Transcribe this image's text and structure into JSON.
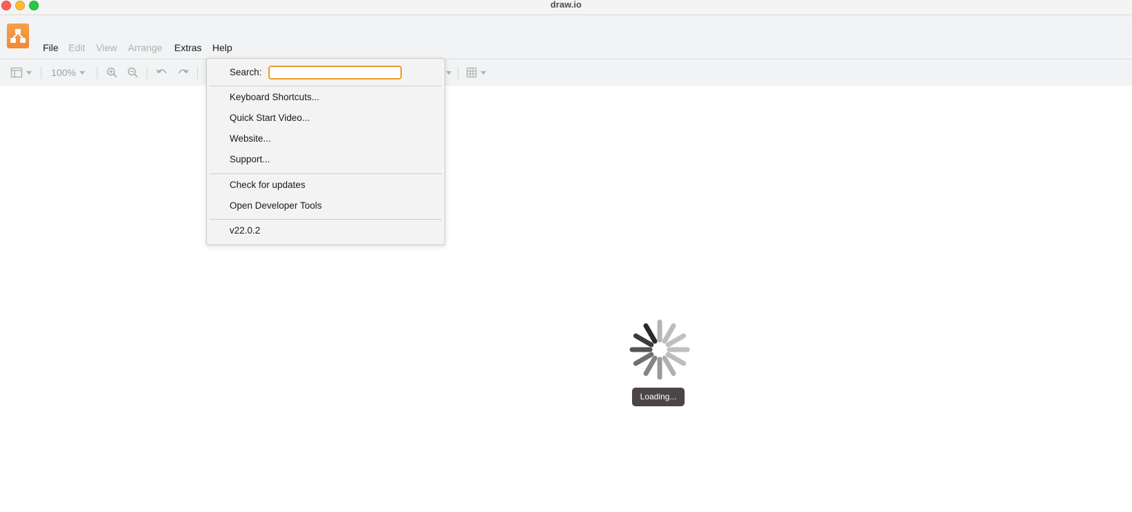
{
  "window": {
    "title": "draw.io"
  },
  "menubar": {
    "items": [
      {
        "label": "File",
        "enabled": true
      },
      {
        "label": "Edit",
        "enabled": false
      },
      {
        "label": "View",
        "enabled": false
      },
      {
        "label": "Arrange",
        "enabled": false
      },
      {
        "label": "Extras",
        "enabled": true
      },
      {
        "label": "Help",
        "enabled": true
      }
    ]
  },
  "toolbar": {
    "zoom_label": "100%",
    "icons": [
      "format-panel-icon",
      "zoom-in-icon",
      "zoom-out-icon",
      "undo-icon",
      "redo-icon",
      "table-icon"
    ]
  },
  "help_menu": {
    "search_label": "Search:",
    "search_value": "",
    "items": [
      "Keyboard Shortcuts...",
      "Quick Start Video...",
      "Website...",
      "Support...",
      "Check for updates",
      "Open Developer Tools",
      "v22.0.2"
    ]
  },
  "loading": {
    "label": "Loading..."
  },
  "colors": {
    "brand": "#f08a38",
    "search_focus": "#e99a2a",
    "loading_badge": "#4c4545"
  }
}
